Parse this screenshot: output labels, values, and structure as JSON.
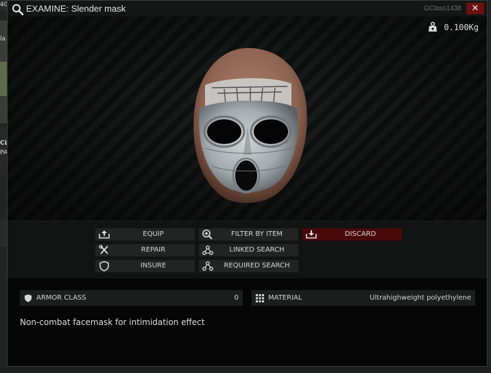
{
  "window": {
    "title": "EXAMINE: Slender mask",
    "class_id": "GClass1438",
    "close_label": "✕"
  },
  "item": {
    "weight": "0.100Kg",
    "description": "Non-combat facemask for intimidation effect"
  },
  "actions": [
    {
      "id": "equip",
      "label": "EQUIP",
      "icon": "equip-icon"
    },
    {
      "id": "filter",
      "label": "FILTER BY ITEM",
      "icon": "filter-magnifier-icon"
    },
    {
      "id": "discard",
      "label": "DISCARD",
      "icon": "discard-icon"
    },
    {
      "id": "repair",
      "label": "REPAIR",
      "icon": "wrench-screwdriver-icon"
    },
    {
      "id": "linked",
      "label": "LINKED SEARCH",
      "icon": "linked-nodes-icon"
    },
    {
      "id": "insure",
      "label": "INSURE",
      "icon": "shield-icon"
    },
    {
      "id": "required",
      "label": "REQUIRED SEARCH",
      "icon": "required-nodes-icon"
    }
  ],
  "stats": [
    {
      "key": "ARMOR CLASS",
      "value": "0",
      "icon": "armor-shield-icon"
    },
    {
      "key": "MATERIAL",
      "value": "Ultrahighweight polyethylene",
      "icon": "material-grid-icon"
    }
  ],
  "background": {
    "fragments": [
      "40",
      "la",
      "CL",
      "PA"
    ]
  },
  "colors": {
    "discard": "#4a0909",
    "close": "#6d1010",
    "button": "#222424",
    "window_bg": "#060606"
  }
}
